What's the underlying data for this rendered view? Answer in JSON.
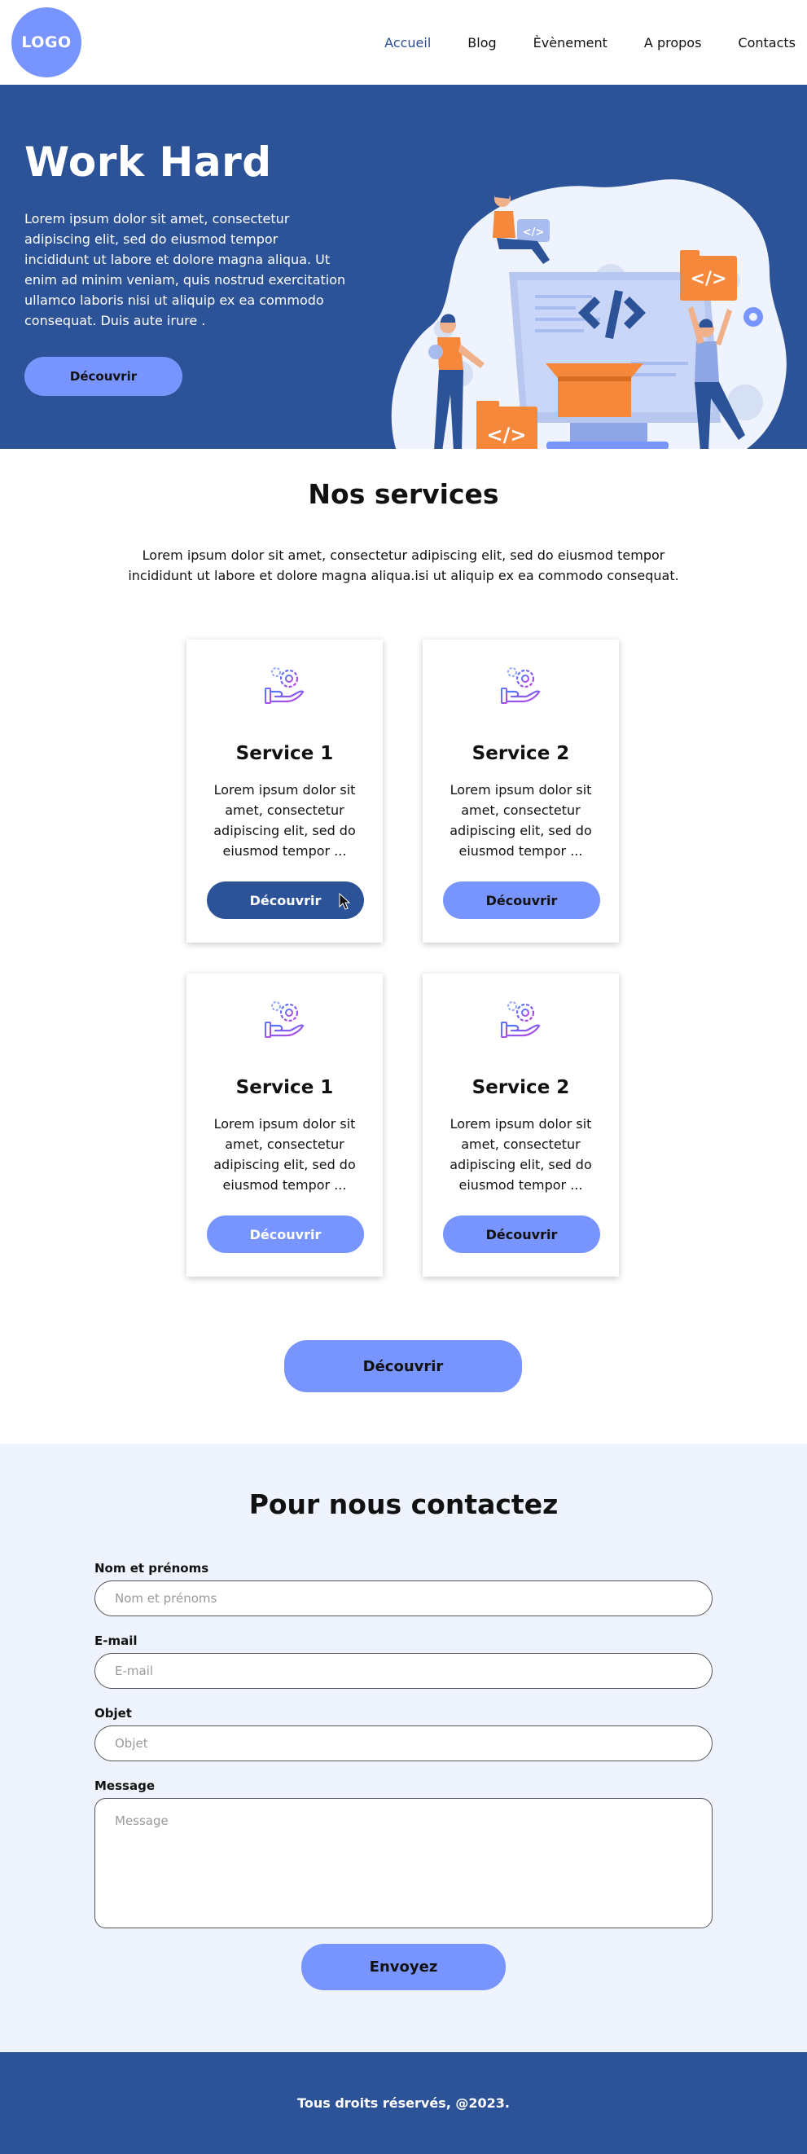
{
  "header": {
    "logo": "LOGO",
    "nav": [
      {
        "label": "Accueil",
        "active": true
      },
      {
        "label": "Blog",
        "active": false
      },
      {
        "label": "Èvènement",
        "active": false
      },
      {
        "label": "A propos",
        "active": false
      },
      {
        "label": "Contacts",
        "active": false
      }
    ]
  },
  "hero": {
    "title": "Work Hard",
    "text": "Lorem ipsum dolor sit amet, consectetur adipiscing elit, sed do eiusmod tempor incididunt ut labore et dolore magna aliqua. Ut enim ad minim veniam, quis nostrud exercitation ullamco laboris nisi ut aliquip ex ea commodo consequat. Duis aute irure .",
    "button": "Découvrir"
  },
  "services": {
    "title": "Nos services",
    "description": "Lorem ipsum dolor sit amet, consectetur adipiscing elit, sed do eiusmod tempor incididunt ut labore et dolore magna aliqua.isi ut aliquip ex ea commodo consequat.",
    "cards": [
      {
        "title": "Service 1",
        "text": "Lorem ipsum dolor sit amet, consectetur adipiscing elit, sed do eiusmod tempor ...",
        "button": "Découvrir"
      },
      {
        "title": "Service 2",
        "text": "Lorem ipsum dolor sit amet, consectetur adipiscing elit, sed do eiusmod tempor ...",
        "button": "Découvrir"
      },
      {
        "title": "Service 1",
        "text": "Lorem ipsum dolor sit amet, consectetur adipiscing elit, sed do eiusmod tempor ...",
        "button": "Découvrir"
      },
      {
        "title": "Service 2",
        "text": "Lorem ipsum dolor sit amet, consectetur adipiscing elit, sed do eiusmod tempor ...",
        "button": "Découvrir"
      }
    ],
    "more_button": "Découvrir"
  },
  "contact": {
    "title": "Pour nous contactez",
    "fields": {
      "name": {
        "label": "Nom et prénoms",
        "placeholder": "Nom et prénoms"
      },
      "email": {
        "label": "E-mail",
        "placeholder": "E-mail"
      },
      "subject": {
        "label": "Objet",
        "placeholder": "Objet"
      },
      "message": {
        "label": "Message",
        "placeholder": "Message"
      }
    },
    "send_button": "Envoyez"
  },
  "footer": {
    "text": "Tous droits réservés, @2023."
  },
  "colors": {
    "primary_dark": "#2c5298",
    "accent": "#7895ff",
    "contact_bg": "#eef3fd",
    "illustration_orange": "#f5883a"
  },
  "icons": [
    "gear-hand-icon",
    "cursor-icon",
    "code-icon"
  ]
}
